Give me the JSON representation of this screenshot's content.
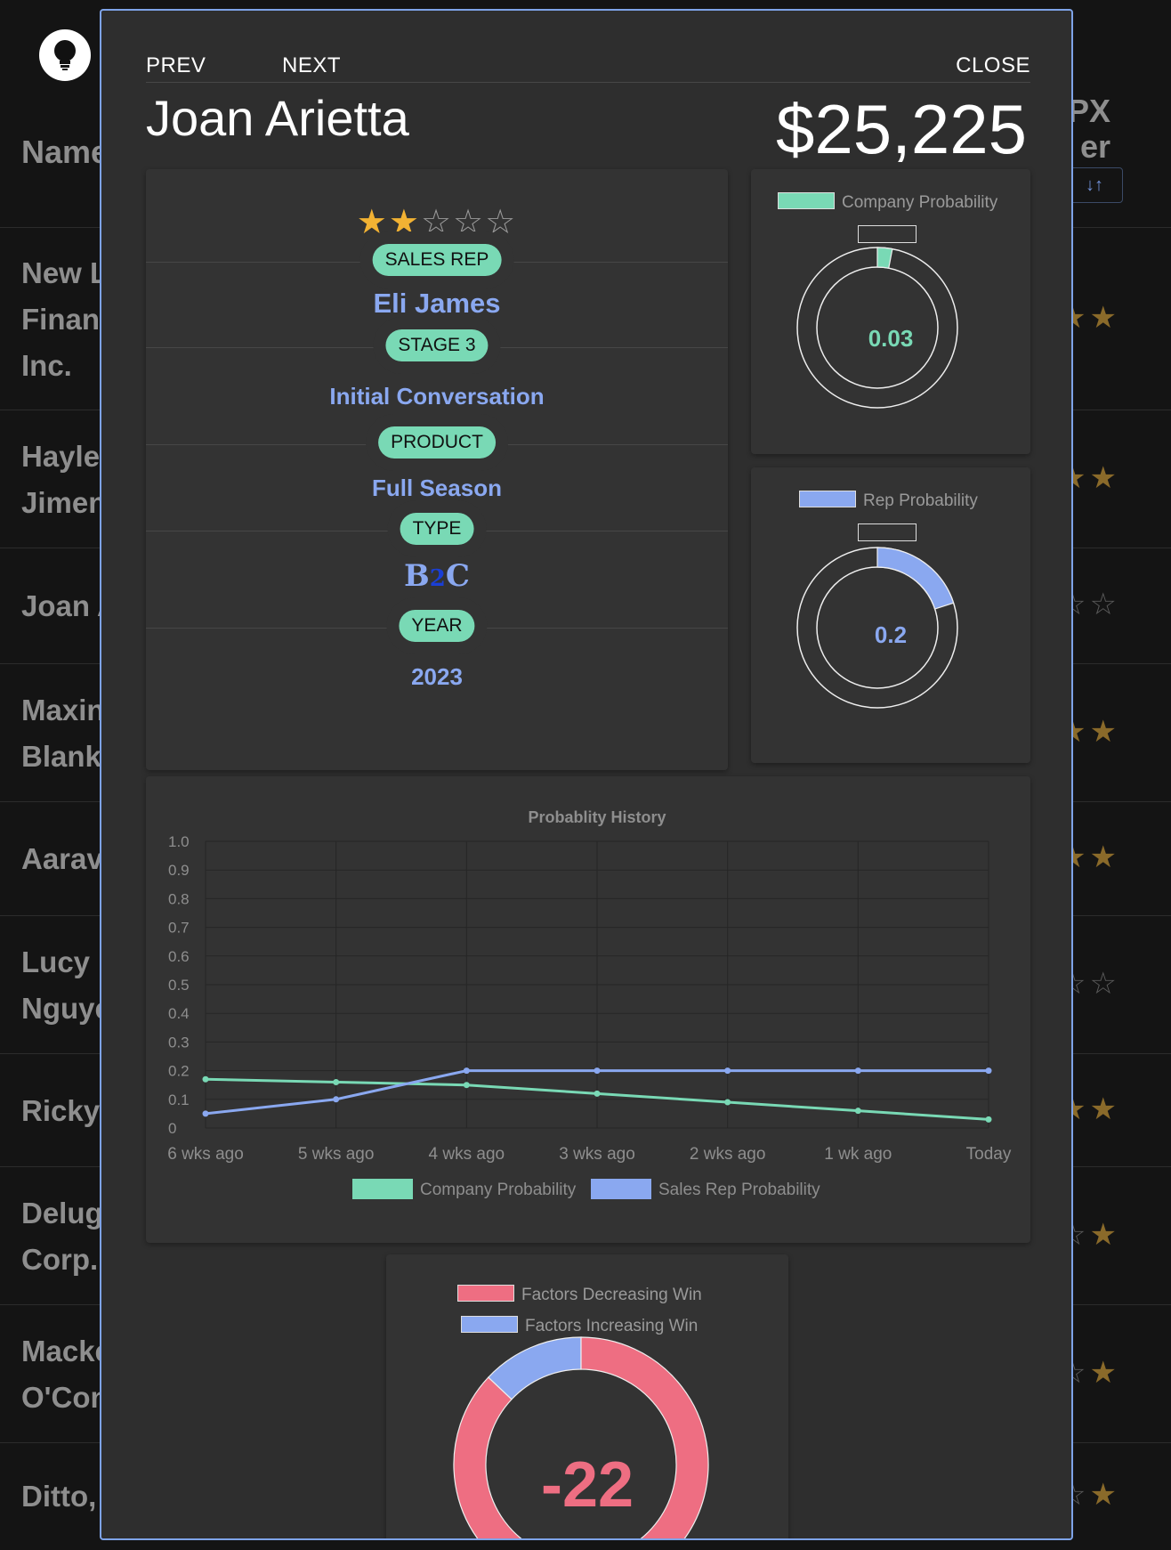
{
  "background": {
    "column_header": "Name",
    "right_header": "PX\ner",
    "sort_icons": "↓↑",
    "rows": [
      {
        "name": "New L\nFinanc\nInc.",
        "stars": 2
      },
      {
        "name": "Hayle\nJimen",
        "stars": 3
      },
      {
        "name": "Joan A",
        "stars": 0
      },
      {
        "name": "Maxin\nBlank",
        "stars": 3
      },
      {
        "name": "Aarav",
        "stars": 2
      },
      {
        "name": "Lucy\nNguye",
        "stars": 0
      },
      {
        "name": "Ricky",
        "stars": 2
      },
      {
        "name": "Delug\nCorp.",
        "stars": 1
      },
      {
        "name": "Macke\nO'Con",
        "stars": 1
      },
      {
        "name": "Ditto,",
        "stars": 1
      }
    ]
  },
  "modal": {
    "nav": {
      "prev": "PREV",
      "next": "NEXT",
      "close": "CLOSE"
    },
    "title": "Joan Arietta",
    "amount": "$25,225",
    "rating": 2,
    "rating_max": 5,
    "fields": {
      "sales_rep_label": "SALES REP",
      "sales_rep": "Eli James",
      "stage_label": "STAGE 3",
      "stage": "Initial Conversation",
      "product_label": "PRODUCT",
      "product": "Full Season",
      "type_label": "TYPE",
      "type_parts": [
        "B",
        "2",
        "C"
      ],
      "year_label": "YEAR",
      "year": "2023"
    },
    "company_donut": {
      "legend": "Company Probability",
      "value": 0.03,
      "label": "0.03",
      "color": "#79d9b5"
    },
    "rep_donut": {
      "legend": "Rep Probability",
      "value": 0.2,
      "label": "0.2",
      "color": "#8aa8f0"
    },
    "factors": {
      "legend_decreasing": "Factors Decreasing Win",
      "legend_increasing": "Factors Increasing Win",
      "score": "-22",
      "decreasing_color": "#ee6e82",
      "increasing_color": "#8aa8f0",
      "increasing_share": 0.13
    }
  },
  "chart_data": {
    "type": "line",
    "title": "Probablity History",
    "categories": [
      "6 wks ago",
      "5 wks ago",
      "4 wks ago",
      "3 wks ago",
      "2 wks ago",
      "1 wk ago",
      "Today"
    ],
    "ylim": [
      0,
      1.0
    ],
    "yticks": [
      "0",
      "0.1",
      "0.2",
      "0.3",
      "0.4",
      "0.5",
      "0.6",
      "0.7",
      "0.8",
      "0.9",
      "1.0"
    ],
    "grid": true,
    "legend_position": "bottom",
    "series": [
      {
        "name": "Company Probability",
        "color": "#79d9b5",
        "values": [
          0.17,
          0.16,
          0.15,
          0.12,
          0.09,
          0.06,
          0.03
        ]
      },
      {
        "name": "Sales Rep Probability",
        "color": "#8aa8f0",
        "values": [
          0.05,
          0.1,
          0.2,
          0.2,
          0.2,
          0.2,
          0.2
        ]
      }
    ]
  }
}
